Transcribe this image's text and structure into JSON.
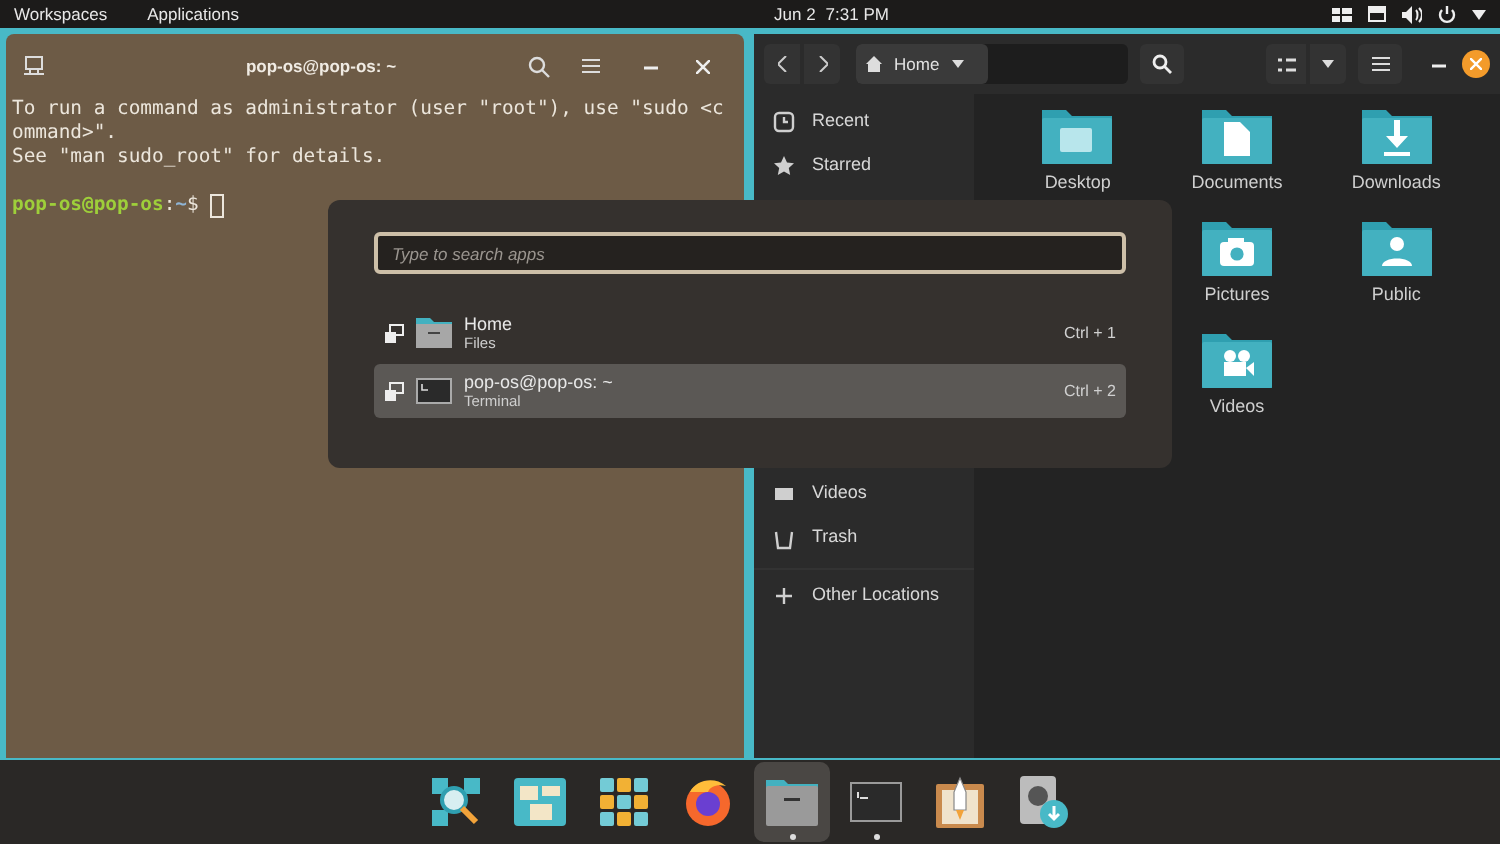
{
  "top_bar": {
    "menus": [
      "Workspaces",
      "Applications"
    ],
    "date": "Jun 2",
    "time": "7:31 PM"
  },
  "terminal": {
    "title": "pop-os@pop-os: ~",
    "lines": [
      "To run a command as administrator (user \"root\"), use \"sudo <c",
      "ommand>\".",
      "See \"man sudo_root\" for details."
    ],
    "prompt": {
      "user_host": "pop-os@pop-os",
      "separator": ":",
      "path": "~",
      "symbol": "$"
    }
  },
  "files": {
    "path_button": "Home",
    "sidebar_top": [
      {
        "label": "Recent",
        "kind": "clock"
      },
      {
        "label": "Starred",
        "kind": "star"
      }
    ],
    "sidebar_bottom": [
      {
        "label": "Videos",
        "kind": "video"
      },
      {
        "label": "Trash",
        "kind": "trash"
      }
    ],
    "other_locations": "Other Locations",
    "folder_rows": [
      [
        {
          "label": "Desktop",
          "kind": "desktop"
        },
        {
          "label": "Documents",
          "kind": "document"
        },
        {
          "label": "Downloads",
          "kind": "download"
        }
      ],
      [
        {
          "label": "Pictures",
          "kind": "camera"
        },
        {
          "label": "Public",
          "kind": "person"
        }
      ],
      [
        {
          "label": "Videos",
          "kind": "video"
        }
      ]
    ]
  },
  "launcher": {
    "placeholder": "Type to search apps",
    "results": [
      {
        "name": "Home",
        "app": "Files",
        "shortcut": "Ctrl + 1",
        "kind": "folder",
        "selected": false
      },
      {
        "name": "pop-os@pop-os: ~",
        "app": "Terminal",
        "shortcut": "Ctrl + 2",
        "kind": "terminal",
        "selected": true
      }
    ]
  },
  "dock": [
    {
      "kind": "search",
      "running": false,
      "active": false
    },
    {
      "kind": "workspaces",
      "running": false,
      "active": false
    },
    {
      "kind": "grid",
      "running": false,
      "active": false
    },
    {
      "kind": "browser",
      "running": false,
      "active": false
    },
    {
      "kind": "folder",
      "running": true,
      "active": true
    },
    {
      "kind": "terminal",
      "running": true,
      "active": false
    },
    {
      "kind": "installer",
      "running": false,
      "active": false
    },
    {
      "kind": "disk",
      "running": false,
      "active": false
    }
  ]
}
